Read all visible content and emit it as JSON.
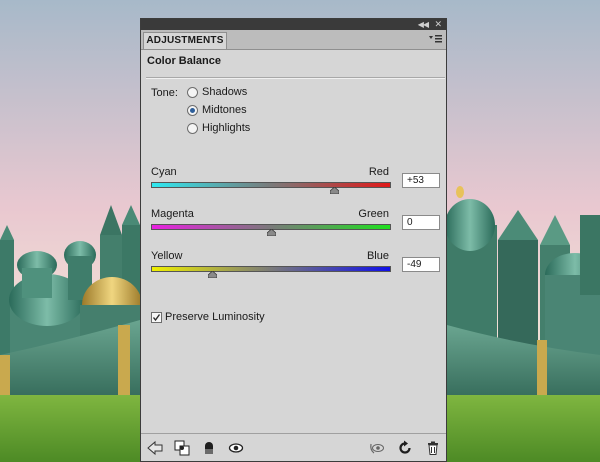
{
  "panel": {
    "tab_label": "ADJUSTMENTS",
    "title": "Color Balance"
  },
  "tone": {
    "label": "Tone:",
    "options": [
      "Shadows",
      "Midtones",
      "Highlights"
    ],
    "selected": "Midtones"
  },
  "sliders": [
    {
      "left": "Cyan",
      "right": "Red",
      "value": "+53",
      "level": 53
    },
    {
      "left": "Magenta",
      "right": "Green",
      "value": "0",
      "level": 0
    },
    {
      "left": "Yellow",
      "right": "Blue",
      "value": "-49",
      "level": -49
    }
  ],
  "preserve_luminosity": {
    "label": "Preserve Luminosity",
    "checked": true
  },
  "icons": {
    "bottom": [
      "back-arrow-icon",
      "clip-to-layer-icon",
      "visibility-mask-icon",
      "eye-icon",
      "view-previous-state-icon",
      "reset-icon",
      "trash-icon"
    ]
  },
  "colors": {
    "cyan": "#2ee8f0",
    "red": "#e01818",
    "magenta": "#e820e0",
    "green": "#20e020",
    "yellow": "#f0f000",
    "blue": "#1010e8",
    "accent": "#2d5e9a"
  }
}
